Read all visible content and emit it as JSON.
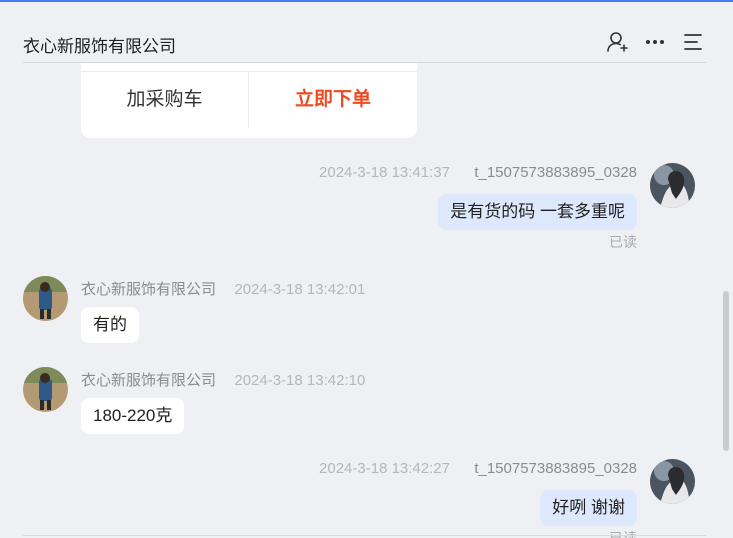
{
  "header": {
    "title": "衣心新服饰有限公司"
  },
  "icons": {
    "add_contact": "user-add-icon",
    "more": "more-icon",
    "menu": "menu-icon"
  },
  "product_card": {
    "add_to_cart": "加采购车",
    "buy_now": "立即下单"
  },
  "messages": [
    {
      "direction": "out",
      "time": "2024-3-18 13:41:37",
      "sender": "t_1507573883895_0328",
      "text": "是有货的码 一套多重呢",
      "status": "已读"
    },
    {
      "direction": "in",
      "sender": "衣心新服饰有限公司",
      "time": "2024-3-18 13:42:01",
      "text": "有的"
    },
    {
      "direction": "in",
      "sender": "衣心新服饰有限公司",
      "time": "2024-3-18 13:42:10",
      "text": "180-220克"
    },
    {
      "direction": "out",
      "time": "2024-3-18 13:42:27",
      "sender": "t_1507573883895_0328",
      "text": "好咧  谢谢",
      "status": "已读"
    }
  ],
  "colors": {
    "accent": "#4a7cf0",
    "buy_now": "#ee4a1f",
    "outgoing_bubble": "#dde8fc",
    "incoming_bubble": "#ffffff",
    "background": "#eff0f4"
  }
}
